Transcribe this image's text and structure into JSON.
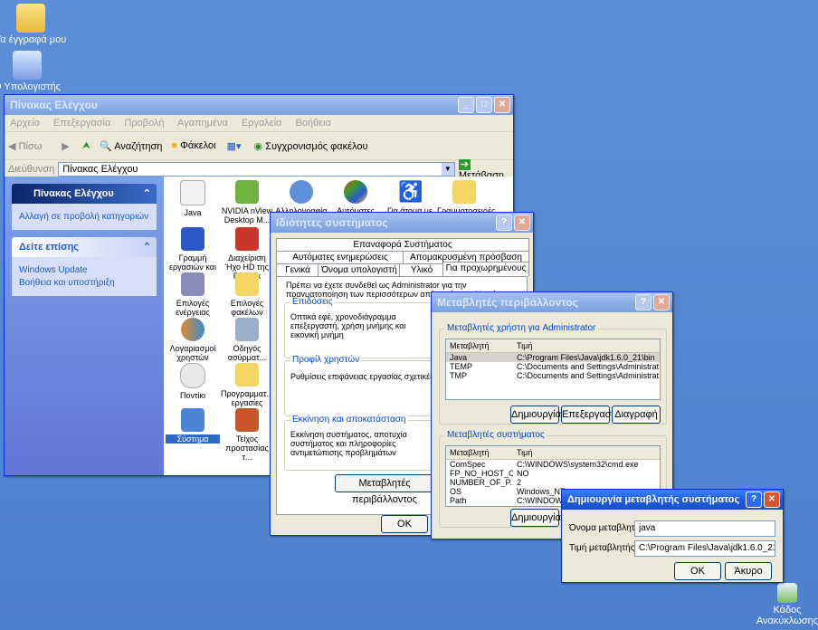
{
  "desktop": {
    "icons": [
      {
        "label": "Τα έγγραφά μου",
        "icon": "my-documents-icon"
      },
      {
        "label": "Ο Υπολογιστής μου",
        "icon": "my-computer-icon"
      },
      {
        "label": "Κάδος Ανακύκλωσης",
        "icon": "recycle-bin-icon"
      }
    ]
  },
  "control_panel": {
    "title": "Πίνακας Ελέγχου",
    "menu": [
      "Αρχείο",
      "Επεξεργασία",
      "Προβολή",
      "Αγαπημένα",
      "Εργαλεία",
      "Βοήθεια"
    ],
    "toolbar": {
      "back": "Πίσω",
      "search": "Αναζήτηση",
      "folders": "Φάκελοι",
      "sync": "Συγχρονισμός φακέλου"
    },
    "address_label": "Διεύθυνση",
    "address_value": "Πίνακας Ελέγχου",
    "go_label": "Μετάβαση",
    "left_panel": {
      "title": "Πίνακας Ελέγχου",
      "switch_view": "Αλλαγή σε προβολή κατηγοριών",
      "see_also_title": "Δείτε επίσης",
      "see_also": [
        "Windows Update",
        "Βοήθεια και υποστήριξη"
      ]
    },
    "items": [
      "Java",
      "NVIDIA nView Desktop M...",
      "Αλληλογραφία",
      "Αυτόματες ενημερώσεις",
      "Για άτομα με ειδικές ανάγκες",
      "Γραμματοσειρές",
      "Γραμμή εργασιών και ...",
      "Διαχείριση Ήχο HD της Realtek",
      "Επιλογές ενέργειας",
      "Επιλογές φακέλων",
      "Λογαριασμοί χρηστών",
      "Οδηγός ασύρματ...",
      "Ποντίκι",
      "Προγραμματ... εργασίες",
      "Σύστημα",
      "Τείχος προστασίας τ..."
    ]
  },
  "system_props": {
    "title": "Ιδιότητες συστήματος",
    "tabs_row1": [
      "Επαναφορά Συστήματος"
    ],
    "tabs_row2": [
      "Αυτόματες ενημερώσεις",
      "Απομακρυσμένη πρόσβαση"
    ],
    "tabs_row3": [
      "Γενικά",
      "Όνομα υπολογιστή",
      "Υλικό",
      "Για προχωρημένους"
    ],
    "intro": "Πρέπει να έχετε συνδεθεί ως Administrator για την πραγματοποίηση των περισσότερων από αυτές τις αλλαγές.",
    "perf_label": "Επιδόσεις",
    "perf_text": "Οπτικά εφέ, χρονοδιάγραμμα επεξεργαστή, χρήση μνήμης και εικονική μνήμη",
    "profiles_label": "Προφίλ χρηστών",
    "profiles_text": "Ρυθμίσεις επιφάνειας εργασίας σχετικές με",
    "startup_label": "Εκκίνηση και αποκατάσταση",
    "startup_text": "Εκκίνηση συστήματος, αποτυχία συστήματος και πληροφορίες αντιμετώπισης προβλημάτων",
    "env_button": "Μεταβλητές περιβάλλοντος",
    "ok": "OK"
  },
  "env_vars": {
    "title": "Μεταβλητές περιβάλλοντος",
    "user_label": "Μεταβλητές χρήστη για Administrator",
    "col_var": "Μεταβλητή",
    "col_val": "Τιμή",
    "user_rows": [
      {
        "name": "Java",
        "value": "C:\\Program Files\\Java\\jdk1.6.0_21\\bin"
      },
      {
        "name": "TEMP",
        "value": "C:\\Documents and Settings\\Administrat..."
      },
      {
        "name": "TMP",
        "value": "C:\\Documents and Settings\\Administrat..."
      }
    ],
    "new": "Δημιουργία",
    "edit": "Επεξεργασία",
    "delete": "Διαγραφή",
    "sys_label": "Μεταβλητές συστήματος",
    "sys_rows": [
      {
        "name": "ComSpec",
        "value": "C:\\WINDOWS\\system32\\cmd.exe"
      },
      {
        "name": "FP_NO_HOST_C...",
        "value": "NO"
      },
      {
        "name": "NUMBER_OF_P...",
        "value": "2"
      },
      {
        "name": "OS",
        "value": "Windows_NT"
      },
      {
        "name": "Path",
        "value": "C:\\WINDOWS\\s"
      }
    ],
    "sys_new": "Δημιουργία"
  },
  "new_var": {
    "title": "Δημιουργία μεταβλητής συστήματος",
    "name_label": "Όνομα μεταβλητής:",
    "name_value": "java",
    "value_label": "Τιμή μεταβλητής:",
    "value_value": "C:\\Program Files\\Java\\jdk1.6.0_21\\bin",
    "ok": "OK",
    "cancel": "Άκυρο"
  }
}
